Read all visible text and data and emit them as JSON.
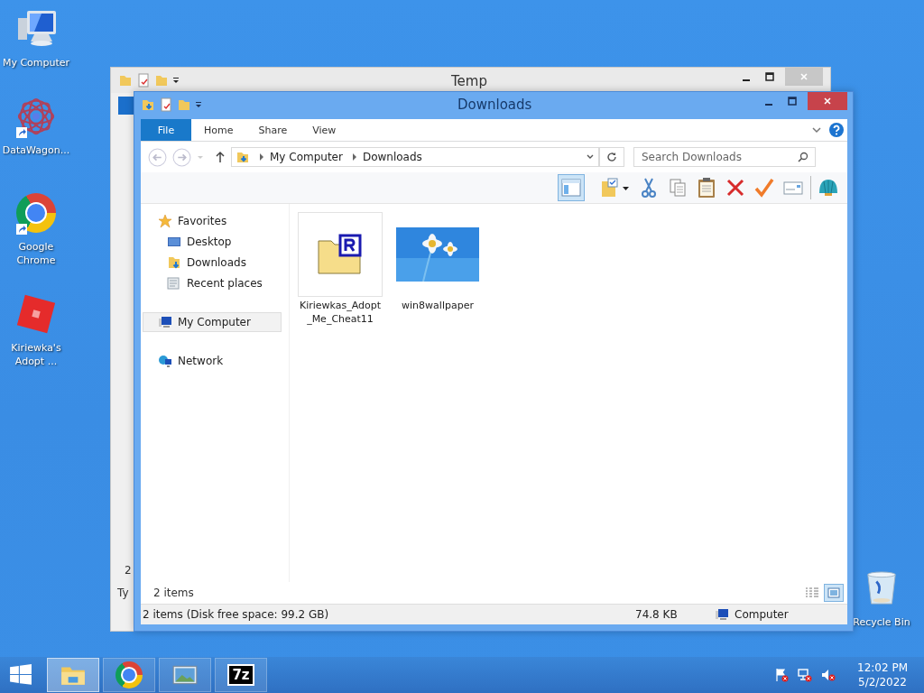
{
  "desktop_icons": [
    {
      "label": "My Computer",
      "kind": "computer",
      "shortcut": false
    },
    {
      "label": "DataWagon...",
      "kind": "flower",
      "shortcut": true
    },
    {
      "label": "Google Chrome",
      "kind": "browser",
      "shortcut": true
    },
    {
      "label": "Kiriewka's Adopt ...",
      "kind": "block",
      "shortcut": false
    }
  ],
  "recycle_bin": {
    "label": "Recycle Bin"
  },
  "back_window": {
    "title": "Temp",
    "fragments": [
      "2",
      "Ty"
    ]
  },
  "window": {
    "title": "Downloads",
    "ribbon_tabs": [
      {
        "label": "File",
        "selected": true
      },
      {
        "label": "Home",
        "selected": false
      },
      {
        "label": "Share",
        "selected": false
      },
      {
        "label": "View",
        "selected": false
      }
    ],
    "address": [
      "My Computer",
      "Downloads"
    ],
    "search": {
      "placeholder": "Search Downloads"
    },
    "toolbar": [
      {
        "kind": "pane",
        "selected": true
      },
      {
        "kind": "folder-check",
        "selected": false
      },
      {
        "kind": "cut",
        "selected": false
      },
      {
        "kind": "copy",
        "selected": false
      },
      {
        "kind": "paste",
        "selected": false
      },
      {
        "kind": "delete",
        "selected": false
      },
      {
        "kind": "check",
        "selected": false
      },
      {
        "kind": "card",
        "selected": false
      },
      {
        "kind": "shell",
        "selected": false
      }
    ],
    "nav": [
      {
        "label": "Favorites",
        "kind": "star",
        "selected": false,
        "children": [
          {
            "label": "Desktop",
            "kind": "desktop",
            "selected": false
          },
          {
            "label": "Downloads",
            "kind": "downloads",
            "selected": false
          },
          {
            "label": "Recent places",
            "kind": "recent",
            "selected": false
          }
        ]
      },
      {
        "label": "My Computer",
        "kind": "computer",
        "selected": true
      },
      {
        "label": "Network",
        "kind": "network",
        "selected": false
      }
    ],
    "files": [
      {
        "name": "Kiriewkas_Adopt_Me_Cheat11",
        "kind": "archive",
        "selected": true
      },
      {
        "name": "win8wallpaper",
        "kind": "picture",
        "selected": false
      }
    ],
    "item_count": "2 items",
    "views": [
      {
        "kind": "details",
        "selected": false
      },
      {
        "kind": "large",
        "selected": true
      }
    ],
    "status_bar": {
      "text": "2 items (Disk free space: 99.2 GB)",
      "size": "74.8 KB",
      "location": "Computer"
    }
  },
  "taskbar": {
    "items": [
      {
        "kind": "explorer",
        "selected": true
      },
      {
        "kind": "browser",
        "selected": false
      },
      {
        "kind": "viewer",
        "selected": false
      },
      {
        "kind": "archiver",
        "selected": false,
        "label": "7z"
      }
    ],
    "time": "12:02 PM",
    "date": "5/2/2022"
  }
}
